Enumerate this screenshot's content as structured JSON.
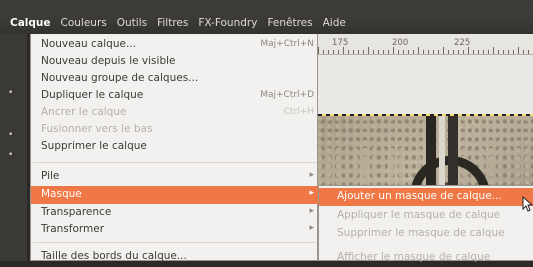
{
  "menubar": {
    "items": [
      "Calque",
      "Couleurs",
      "Outils",
      "Filtres",
      "FX-Foundry",
      "Fenêtres",
      "Aide"
    ],
    "active_index": 0
  },
  "layer_menu": {
    "items": [
      {
        "label": "Nouveau calque...",
        "accel": "Maj+Ctrl+N",
        "enabled": true
      },
      {
        "label": "Nouveau depuis le visible",
        "accel": "",
        "enabled": true
      },
      {
        "label": "Nouveau groupe de calques...",
        "accel": "",
        "enabled": true
      },
      {
        "label": "Dupliquer le calque",
        "accel": "Maj+Ctrl+D",
        "enabled": true
      },
      {
        "label": "Ancrer le calque",
        "accel": "Ctrl+H",
        "enabled": false
      },
      {
        "label": "Fusionner vers le bas",
        "accel": "",
        "enabled": false
      },
      {
        "label": "Supprimer le calque",
        "accel": "",
        "enabled": true
      },
      {
        "label": "Pile",
        "submenu": true,
        "enabled": true
      },
      {
        "label": "Masque",
        "submenu": true,
        "enabled": true,
        "highlighted": true
      },
      {
        "label": "Transparence",
        "submenu": true,
        "enabled": true
      },
      {
        "label": "Transformer",
        "submenu": true,
        "enabled": true
      },
      {
        "label": "Taille des bords du calque...",
        "accel": "",
        "enabled": true
      }
    ]
  },
  "mask_submenu": {
    "items": [
      {
        "label": "Ajouter un masque de calque...",
        "enabled": true,
        "highlighted": true
      },
      {
        "label": "Appliquer le masque de calque",
        "enabled": false
      },
      {
        "label": "Supprimer le masque de calque",
        "enabled": false
      },
      {
        "label": "Afficher le masque de calque",
        "enabled": false
      }
    ]
  },
  "ruler": {
    "labels": [
      "175",
      "200",
      "225"
    ]
  },
  "colors": {
    "highlight": "#f07746",
    "menu_bg": "#f2f1ef",
    "menubar_bg": "#3c3b37"
  }
}
